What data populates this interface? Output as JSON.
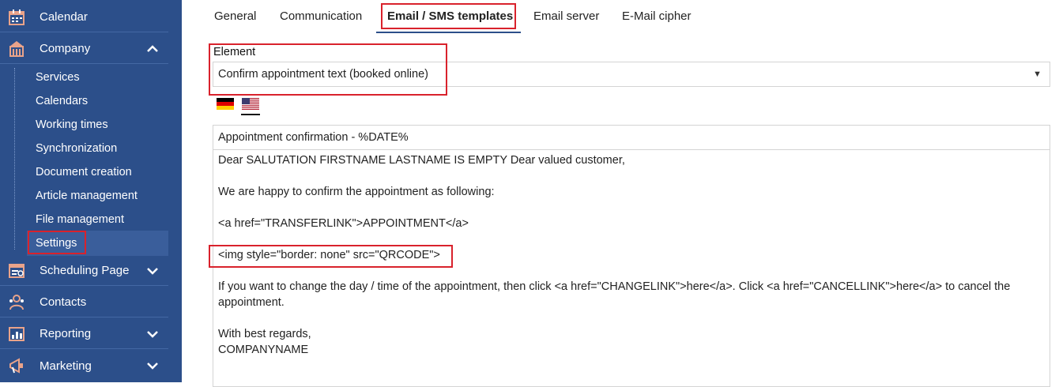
{
  "sidebar": {
    "main_items": [
      {
        "label": "Calendar",
        "icon": "calendar-icon"
      },
      {
        "label": "Company",
        "icon": "company-icon",
        "expanded": true
      },
      {
        "label": "Scheduling Page",
        "icon": "scheduling-page-icon"
      },
      {
        "label": "Contacts",
        "icon": "contacts-icon"
      },
      {
        "label": "Reporting",
        "icon": "reporting-icon"
      },
      {
        "label": "Marketing",
        "icon": "marketing-icon"
      }
    ],
    "sub_items": [
      "Services",
      "Calendars",
      "Working times",
      "Synchronization",
      "Document creation",
      "Article management",
      "File management",
      "Settings"
    ],
    "active_sub_item": "Settings"
  },
  "tabs": [
    "General",
    "Communication",
    "Email / SMS templates",
    "Email server",
    "E-Mail cipher"
  ],
  "active_tab": "Email / SMS templates",
  "element": {
    "label": "Element",
    "selected": "Confirm appointment text (booked online)"
  },
  "languages": [
    {
      "name": "german-flag-icon"
    },
    {
      "name": "us-flag-icon",
      "selected": true
    }
  ],
  "template": {
    "subject": "Appointment confirmation - %DATE%",
    "lines": [
      "Dear SALUTATION FIRSTNAME LASTNAME IS EMPTY Dear valued customer,",
      "We are happy to confirm the appointment as following:",
      "<a href=\"TRANSFERLINK\">APPOINTMENT</a>",
      "<img style=\"border: none\" src=\"QRCODE\">",
      "If you want to change the day / time of the appointment, then click <a href=\"CHANGELINK\">here</a>. Click <a href=\"CANCELLINK\">here</a> to cancel the",
      "appointment.",
      "With best regards,",
      "COMPANYNAME"
    ]
  },
  "colors": {
    "sidebar_bg": "#2c4f8a",
    "highlight_red": "#d9222c"
  }
}
